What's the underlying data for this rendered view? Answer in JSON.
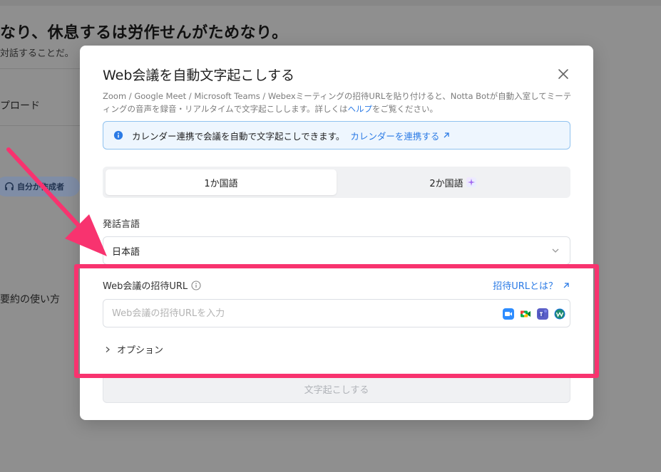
{
  "background": {
    "heading": "なり、休息するは労作せんがためなり。",
    "subtext": "対話することだ。",
    "upload": "プロード",
    "chip": "自分が作成者",
    "summary": "要約の使い方"
  },
  "modal": {
    "title": "Web会議を自動文字起こしする",
    "description_prefix": "Zoom / Google Meet / Microsoft Teams / Webexミーティングの招待URLを貼り付けると、Notta Botが自動入室してミーティングの音声を録音・リアルタイムで文字起こしします。詳しくは",
    "help_link": "ヘルプ",
    "description_suffix": "をご覧ください。",
    "info": {
      "text": "カレンダー連携で会議を自動で文字起こしできます。",
      "link": "カレンダーを連携する"
    },
    "tabs": [
      {
        "label": "1か国語",
        "active": true
      },
      {
        "label": "2か国語",
        "active": false
      }
    ],
    "language": {
      "label": "発話言語",
      "value": "日本語"
    },
    "url": {
      "label": "Web会議の招待URL",
      "what_link": "招待URLとは？",
      "placeholder": "Web会議の招待URLを入力",
      "value": ""
    },
    "platforms": [
      "zoom-icon",
      "google-meet-icon",
      "microsoft-teams-icon",
      "webex-icon"
    ],
    "options_label": "オプション",
    "submit_label": "文字起こしする"
  },
  "colors": {
    "accent": "#2c7be5",
    "annotation": "#f8336f"
  }
}
